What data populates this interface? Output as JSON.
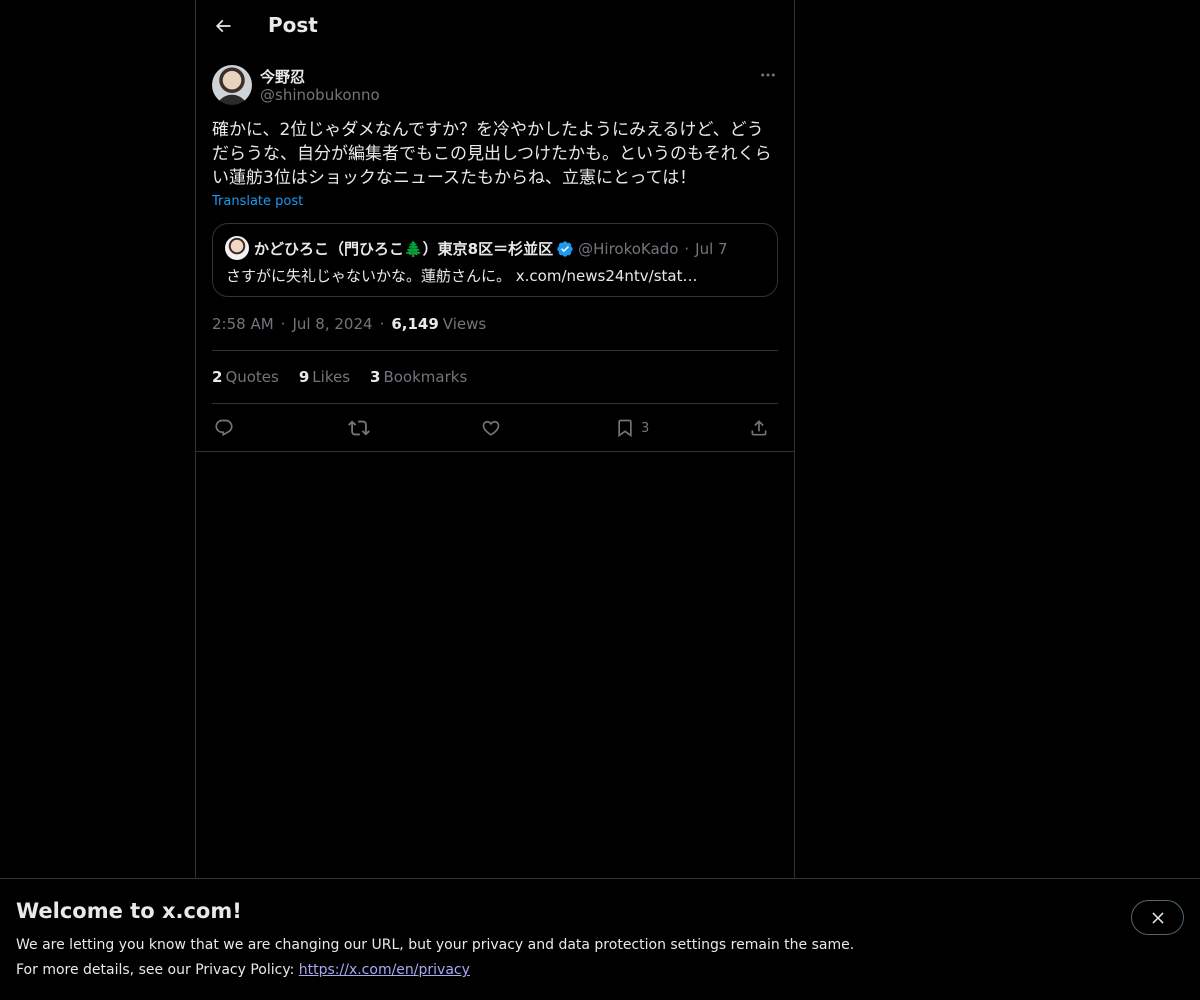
{
  "header": {
    "title": "Post"
  },
  "post": {
    "author_name": "今野忍",
    "author_handle": "@shinobukonno",
    "text": "確かに、2位じゃダメなんですか？を冷やかしたようにみえるけど、どうだらうな、自分が編集者でもこの見出しつけたかも。というのもそれくらい蓮舫3位はショックなニュースたもからね、立憲にとっては！",
    "translate_label": "Translate post",
    "time": "2:58 AM",
    "date": "Jul 8, 2024",
    "views_count": "6,149",
    "views_label": "Views"
  },
  "quote": {
    "name": "かどひろこ（門ひろこ🌲）東京8区＝杉並区",
    "handle": "@HirokoKado",
    "date": "Jul 7",
    "text": "さすがに失礼じゃないかな。蓮舫さんに。 x.com/news24ntv/stat…"
  },
  "stats": [
    {
      "count": "2",
      "label": "Quotes"
    },
    {
      "count": "9",
      "label": "Likes"
    },
    {
      "count": "3",
      "label": "Bookmarks"
    }
  ],
  "actions": {
    "bookmark_count": "3"
  },
  "banner": {
    "title": "Welcome to x.com!",
    "line1": "We are letting you know that we are changing our URL, but your privacy and data protection settings remain the same.",
    "line2_prefix": "For more details, see our Privacy Policy:",
    "link": "https://x.com/en/privacy"
  },
  "colors": {
    "background": "#000000",
    "text": "#e7e9ea",
    "muted": "#71767b",
    "accent": "#1d9bf0",
    "border": "#2f3336",
    "link": "#a9a8f5"
  }
}
